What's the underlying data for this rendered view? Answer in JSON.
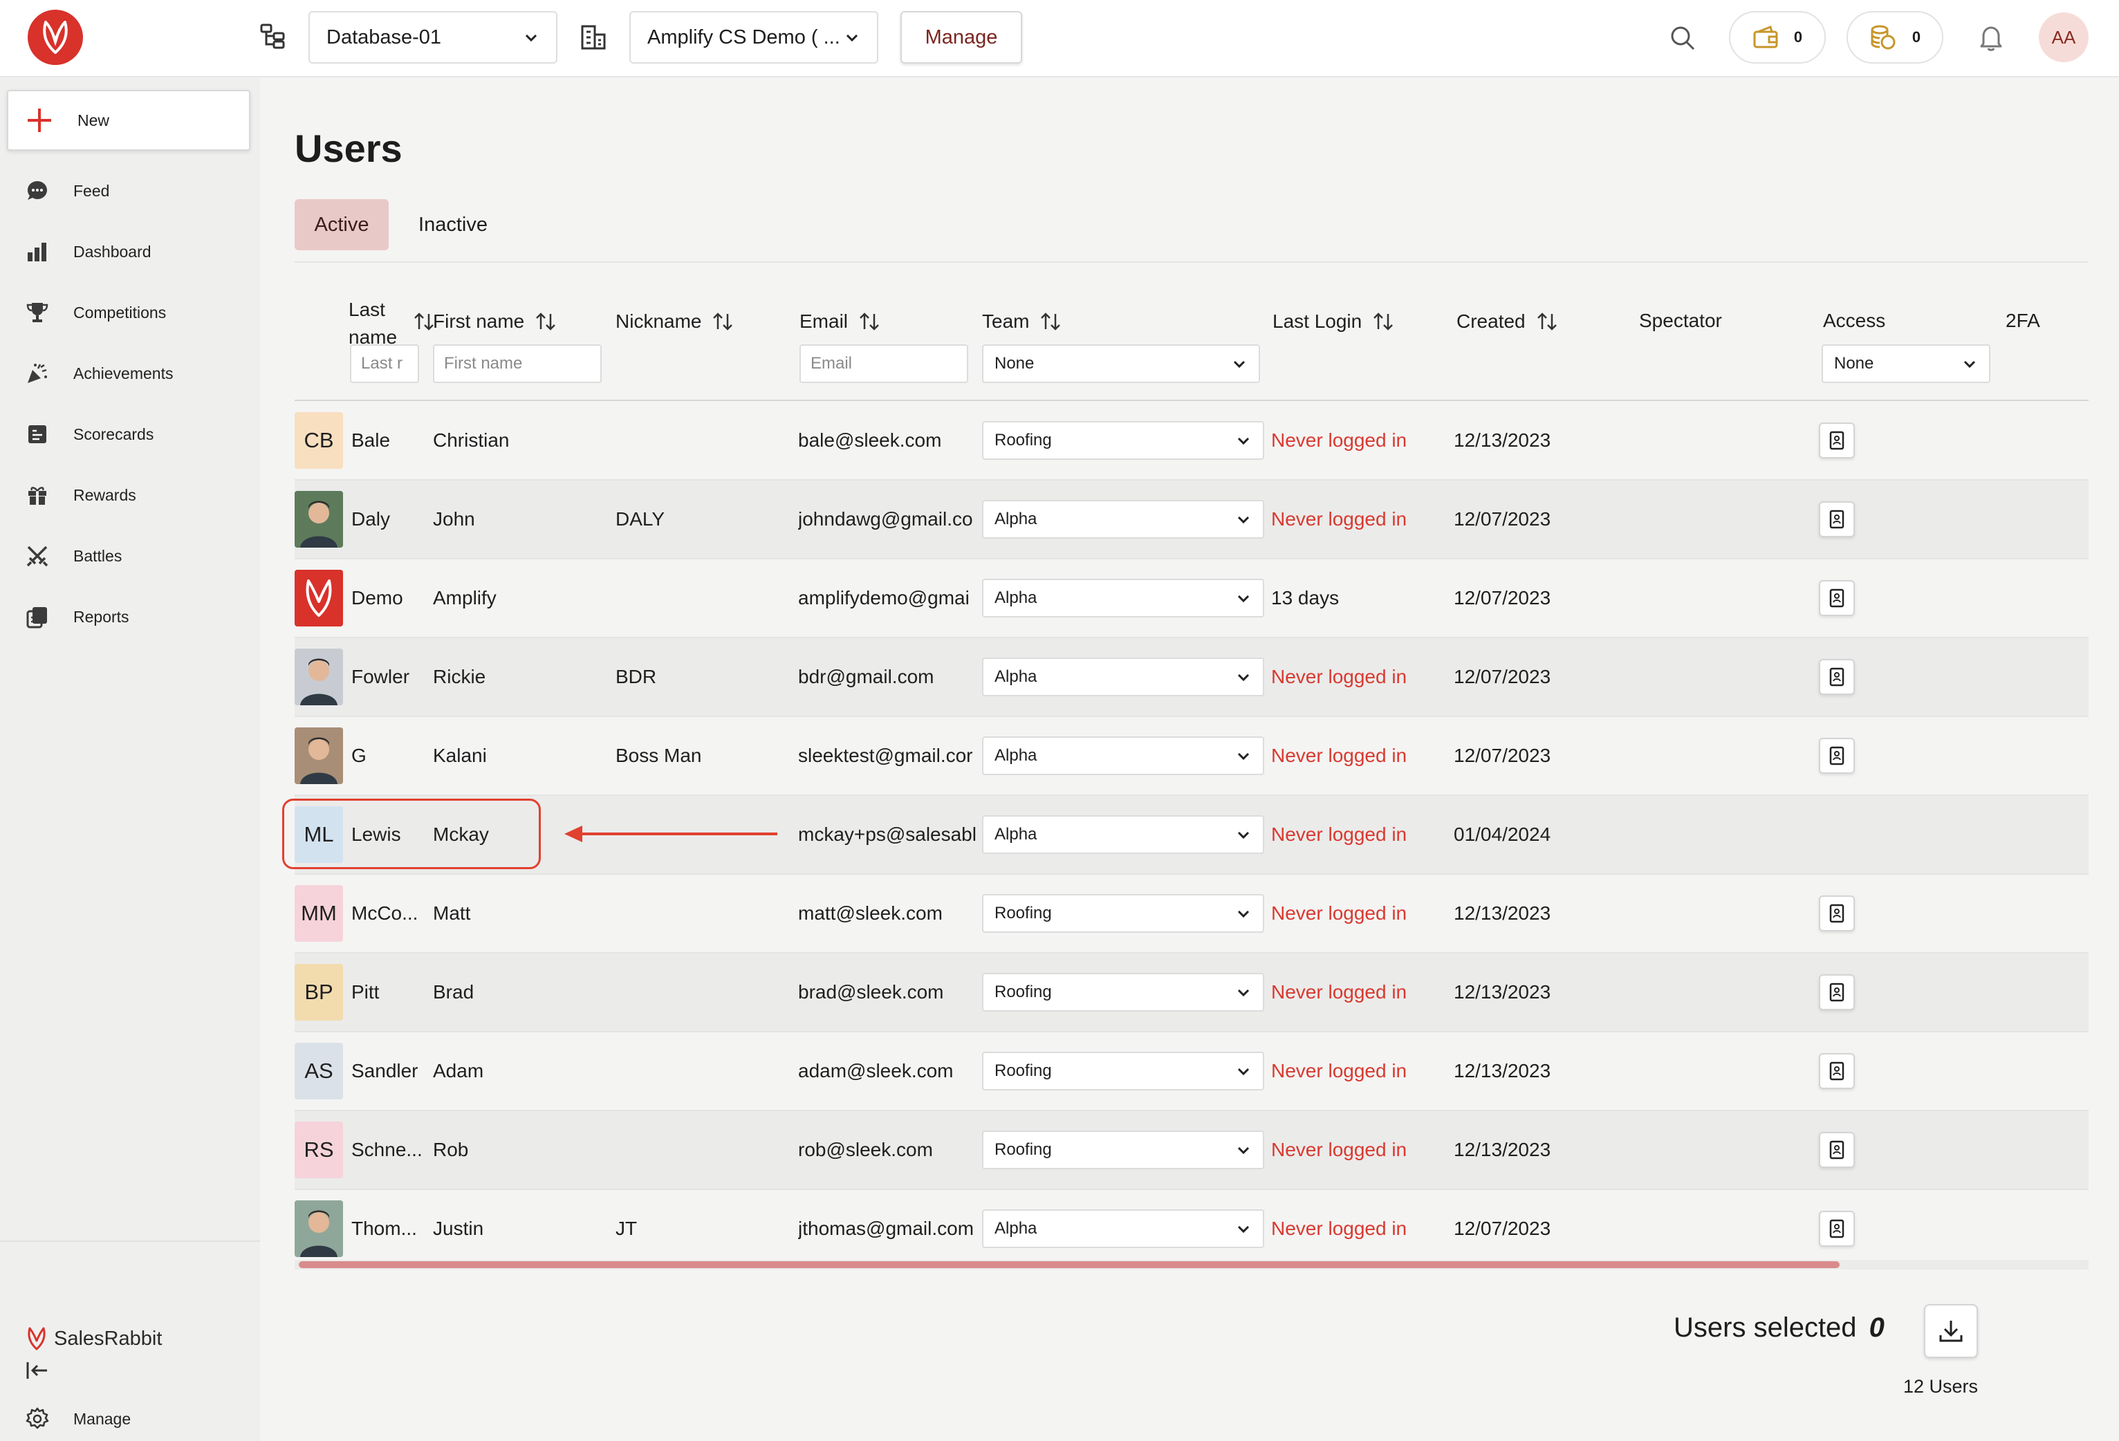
{
  "topbar": {
    "database_select": "Database-01",
    "org_select": "Amplify CS Demo ( ...",
    "manage_label": "Manage",
    "wallet_count": "0",
    "coins_count": "0",
    "user_initials": "AA"
  },
  "sidebar": {
    "new_label": "New",
    "items": [
      {
        "label": "Feed",
        "icon": "chat-icon"
      },
      {
        "label": "Dashboard",
        "icon": "bar-chart-icon"
      },
      {
        "label": "Competitions",
        "icon": "trophy-icon"
      },
      {
        "label": "Achievements",
        "icon": "party-popper-icon"
      },
      {
        "label": "Scorecards",
        "icon": "scorecard-icon"
      },
      {
        "label": "Rewards",
        "icon": "gift-icon"
      },
      {
        "label": "Battles",
        "icon": "crossed-swords-icon"
      },
      {
        "label": "Reports",
        "icon": "reports-icon"
      }
    ],
    "brand": "SalesRabbit",
    "manage_label": "Manage"
  },
  "page": {
    "title": "Users",
    "tabs": {
      "active": "Active",
      "inactive": "Inactive"
    }
  },
  "table": {
    "headers": {
      "last_name": "Last name",
      "first_name": "First name",
      "nickname": "Nickname",
      "email": "Email",
      "team": "Team",
      "last_login": "Last Login",
      "created": "Created",
      "spectator": "Spectator",
      "access": "Access",
      "twofa": "2FA"
    },
    "filters": {
      "last_name_placeholder": "Last r",
      "first_name_placeholder": "First name",
      "email_placeholder": "Email",
      "team_value": "None",
      "access_value": "None"
    },
    "rows": [
      {
        "initials": "CB",
        "avatar_bg": "#f8dfc0",
        "photo": false,
        "last": "Bale",
        "first": "Christian",
        "nick": "",
        "email": "bale@sleek.com",
        "team": "Roofing",
        "login": "Never logged in",
        "never": true,
        "created": "12/13/2023",
        "access": true
      },
      {
        "initials": "",
        "avatar_bg": "#5d7b5a",
        "photo": true,
        "last": "Daly",
        "first": "John",
        "nick": "DALY",
        "email": "johndawg@gmail.co",
        "team": "Alpha",
        "login": "Never logged in",
        "never": true,
        "created": "12/07/2023",
        "access": true
      },
      {
        "initials": "",
        "avatar_bg": "#d8322b",
        "photo": "logo",
        "last": "Demo",
        "first": "Amplify",
        "nick": "",
        "email": "amplifydemo@gmai",
        "team": "Alpha",
        "login": "13 days",
        "never": false,
        "created": "12/07/2023",
        "access": true
      },
      {
        "initials": "",
        "avatar_bg": "#c8ccd2",
        "photo": true,
        "last": "Fowler",
        "first": "Rickie",
        "nick": "BDR",
        "email": "bdr@gmail.com",
        "team": "Alpha",
        "login": "Never logged in",
        "never": true,
        "created": "12/07/2023",
        "access": true
      },
      {
        "initials": "",
        "avatar_bg": "#a88e76",
        "photo": true,
        "last": "G",
        "first": "Kalani",
        "nick": "Boss Man",
        "email": "sleektest@gmail.cor",
        "team": "Alpha",
        "login": "Never logged in",
        "never": true,
        "created": "12/07/2023",
        "access": true
      },
      {
        "initials": "ML",
        "avatar_bg": "#d3e2ef",
        "photo": false,
        "last": "Lewis",
        "first": "Mckay",
        "nick": "",
        "email": "mckay+ps@salesabl",
        "team": "Alpha",
        "login": "Never logged in",
        "never": true,
        "created": "01/04/2024",
        "access": false
      },
      {
        "initials": "MM",
        "avatar_bg": "#f6d3da",
        "photo": false,
        "last": "McCo...",
        "first": "Matt",
        "nick": "",
        "email": "matt@sleek.com",
        "team": "Roofing",
        "login": "Never logged in",
        "never": true,
        "created": "12/13/2023",
        "access": true
      },
      {
        "initials": "BP",
        "avatar_bg": "#f2dcae",
        "photo": false,
        "last": "Pitt",
        "first": "Brad",
        "nick": "",
        "email": "brad@sleek.com",
        "team": "Roofing",
        "login": "Never logged in",
        "never": true,
        "created": "12/13/2023",
        "access": true
      },
      {
        "initials": "AS",
        "avatar_bg": "#dbe1e8",
        "photo": false,
        "last": "Sandler",
        "first": "Adam",
        "nick": "",
        "email": "adam@sleek.com",
        "team": "Roofing",
        "login": "Never logged in",
        "never": true,
        "created": "12/13/2023",
        "access": true
      },
      {
        "initials": "RS",
        "avatar_bg": "#f6d3da",
        "photo": false,
        "last": "Schne...",
        "first": "Rob",
        "nick": "",
        "email": "rob@sleek.com",
        "team": "Roofing",
        "login": "Never logged in",
        "never": true,
        "created": "12/13/2023",
        "access": true
      },
      {
        "initials": "",
        "avatar_bg": "#8fa79a",
        "photo": true,
        "last": "Thom...",
        "first": "Justin",
        "nick": "JT",
        "email": "jthomas@gmail.com",
        "team": "Alpha",
        "login": "Never logged in",
        "never": true,
        "created": "12/07/2023",
        "access": true
      }
    ]
  },
  "footer": {
    "selected_label": "Users selected",
    "selected_count": "0",
    "total": "12 Users"
  },
  "colors": {
    "brand_red": "#d8322b",
    "never_logged_red": "#d9392f",
    "active_tab_bg": "#e9c9c7",
    "annotation_red": "#e0412f"
  }
}
